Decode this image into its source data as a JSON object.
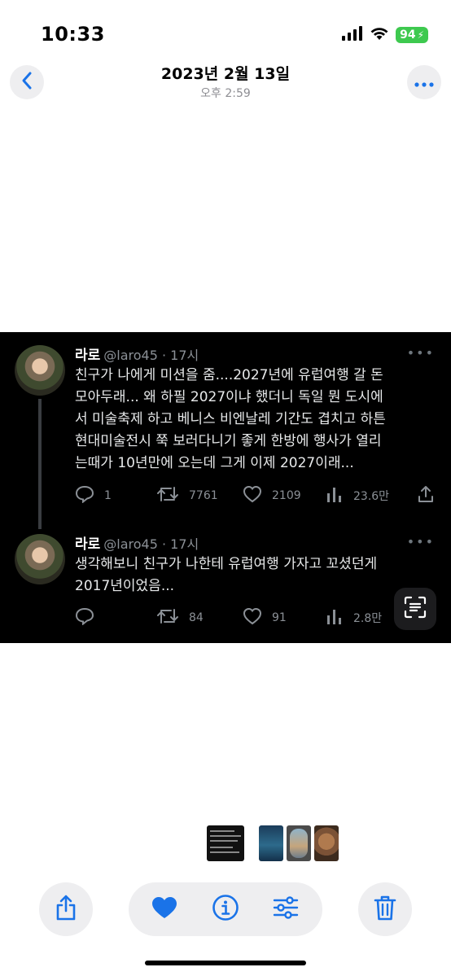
{
  "status_bar": {
    "time": "10:33",
    "battery": "94"
  },
  "header": {
    "title": "2023년 2월 13일",
    "subtitle": "오후 2:59"
  },
  "tweets": [
    {
      "name": "라로",
      "handle": "@laro45 · 17시",
      "text": "친구가 나에게 미션을 줌....2027년에 유럽여행 갈 돈\n모아두래... 왜 하필 2027이냐 했더니 독일 뭔 도시에\n서 미술축제 하고 베니스 비엔날레 기간도 겹치고 하튼\n현대미술전시 쭉 보러다니기 좋게 한방에 행사가 열리\n는때가 10년만에 오는데 그게 이제 2027이래...",
      "replies": "1",
      "retweets": "7761",
      "likes": "2109",
      "views": "23.6만"
    },
    {
      "name": "라로",
      "handle": "@laro45 · 17시",
      "text": "생각해보니 친구가 나한테 유럽여행 가자고 꼬셨던게\n2017년이었음...",
      "replies": "",
      "retweets": "84",
      "likes": "91",
      "views": "2.8만"
    }
  ],
  "icons": [
    "back-chevron-icon",
    "more-icon",
    "reply-icon",
    "retweet-icon",
    "like-icon",
    "views-icon",
    "share-icon",
    "text-scan-icon",
    "heart-icon",
    "info-icon",
    "adjust-icon",
    "trash-icon"
  ],
  "colors": {
    "accent": "#1a73e8",
    "battery": "#3ec94f",
    "tweet_bg": "#000000"
  }
}
